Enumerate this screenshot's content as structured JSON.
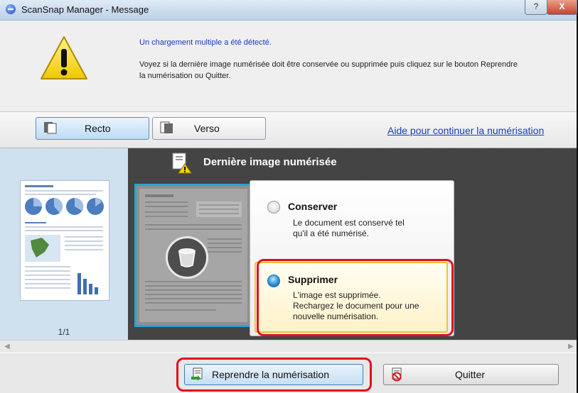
{
  "window": {
    "title": "ScanSnap Manager - Message",
    "help_glyph": "?",
    "close_glyph": "X"
  },
  "message": {
    "title": "Un chargement multiple a été détecté.",
    "body": "Voyez si la dernière image numérisée doit être conservée ou supprimée puis cliquez sur le bouton Reprendre la numérisation ou Quitter."
  },
  "toolbar": {
    "tabs": [
      {
        "label": "Recto",
        "selected": true
      },
      {
        "label": "Verso",
        "selected": false
      }
    ],
    "help_link": "Aide pour continuer la numérisation"
  },
  "thumbnails": {
    "page_counter": "1/1"
  },
  "main": {
    "section_title": "Dernière image numérisée",
    "options": [
      {
        "title": "Conserver",
        "description_lines": [
          "Le document est conservé tel",
          "qu'il a été numérisé."
        ],
        "selected": false
      },
      {
        "title": "Supprimer",
        "description_lines": [
          "L'image est supprimée.",
          "Rechargez le document pour une",
          "nouvelle numérisation."
        ],
        "selected": true
      }
    ]
  },
  "buttons": {
    "resume": "Reprendre la numérisation",
    "quit": "Quitter"
  },
  "colors": {
    "link": "#1a3bbf",
    "highlight": "#e0101c",
    "selection_border": "#29a3d8"
  }
}
